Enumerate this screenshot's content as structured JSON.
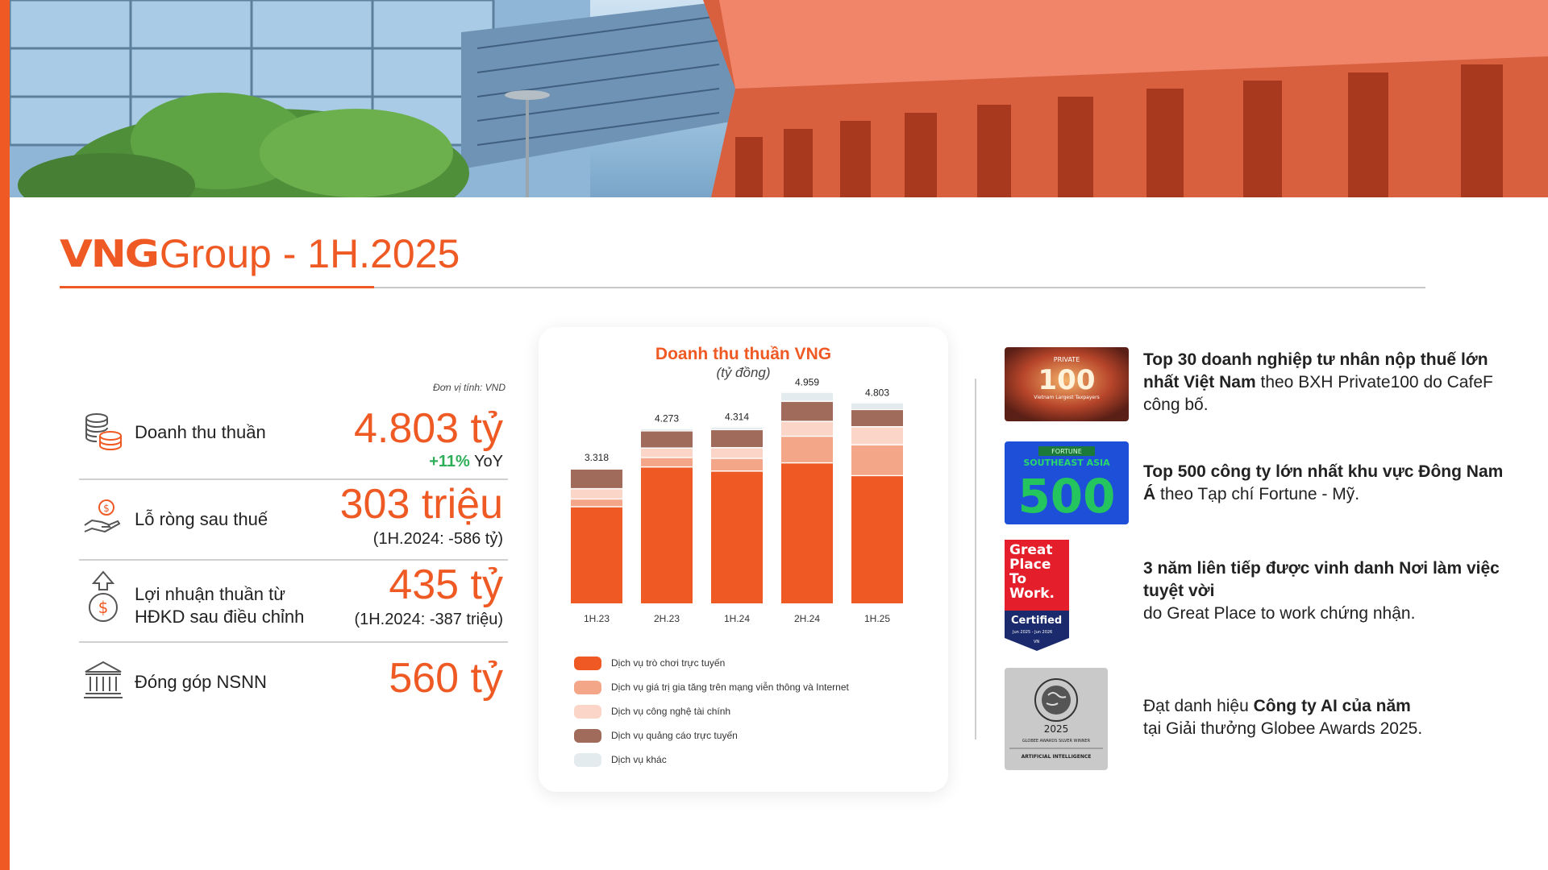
{
  "header": {
    "logo_text": "VNG",
    "title": "Group - 1H.2025"
  },
  "unit_note": "Đơn vị tính: VND",
  "kpis": [
    {
      "icon": "coins-stack-icon",
      "label": "Doanh thu thuần",
      "value": "4.803 tỷ",
      "yoy_change": "+11%",
      "yoy_label": "YoY"
    },
    {
      "icon": "hand-coin-icon",
      "label": "Lỗ ròng sau thuế",
      "value": "303 triệu",
      "note": "(1H.2024: -586 tỷ)"
    },
    {
      "icon": "money-bag-up-icon",
      "label_line1": "Lợi nhuận thuần từ",
      "label_line2": "HĐKD sau điều chỉnh",
      "value": "435 tỷ",
      "note": "(1H.2024: -387 triệu)"
    },
    {
      "icon": "government-building-icon",
      "label": "Đóng góp NSNN",
      "value": "560 tỷ"
    }
  ],
  "chart_data": {
    "type": "bar",
    "stacked": true,
    "title": "Doanh thu thuần VNG",
    "subtitle": "(tỷ đồng)",
    "categories": [
      "1H.23",
      "2H.23",
      "1H.24",
      "2H.24",
      "1H.25"
    ],
    "totals": [
      "3.318",
      "4.273",
      "4.314",
      "4.959",
      "4.803"
    ],
    "total_values": [
      3318,
      4273,
      4314,
      4959,
      4803
    ],
    "ylim": [
      0,
      5400
    ],
    "grid": false,
    "legend_position": "bottom",
    "series": [
      {
        "name": "Dịch vụ trò chơi trực tuyến",
        "color": "#ef5a24",
        "values": [
          2370,
          3340,
          3240,
          3440,
          3130
        ]
      },
      {
        "name": "Dịch vụ giá trị gia tăng trên mạng viễn thông và Internet",
        "color": "#f4a689",
        "values": [
          190,
          230,
          310,
          650,
          750
        ]
      },
      {
        "name": "Dịch vụ công nghệ tài chính",
        "color": "#fbd5c7",
        "values": [
          250,
          230,
          260,
          360,
          440
        ]
      },
      {
        "name": "Dịch vụ quảng cáo trực tuyến",
        "color": "#a06b5a",
        "values": [
          480,
          420,
          440,
          490,
          420
        ]
      },
      {
        "name": "Dịch vụ khác",
        "color": "#e3ebee",
        "values": [
          28,
          53,
          64,
          219,
          163
        ]
      }
    ]
  },
  "awards": [
    {
      "badge": "private-100-badge",
      "badge_text": [
        "PRIVATE",
        "100",
        "Vietnam Largest Taxpayers"
      ],
      "bold": "Top 30 doanh nghiệp tư nhân nộp thuế lớn nhất Việt Nam",
      "rest": " theo BXH Private100 do CafeF công bố."
    },
    {
      "badge": "fortune-sea-500-badge",
      "badge_text": [
        "FORTUNE",
        "SOUTHEAST ASIA",
        "500"
      ],
      "bold": "Top 500 công ty lớn nhất khu vực Đông Nam Á",
      "rest": " theo Tạp chí Fortune - Mỹ."
    },
    {
      "badge": "great-place-to-work-badge",
      "badge_text": [
        "Great",
        "Place",
        "To",
        "Work.",
        "Certified",
        "Jun 2025 - Jun 2026",
        "VN"
      ],
      "bold": "3 năm liên tiếp được vinh danh Nơi làm việc tuyệt vời",
      "rest": "do Great Place to work chứng nhận."
    },
    {
      "badge": "globee-awards-badge",
      "badge_text": [
        "2025",
        "GLOBEE AWARDS SILVER WINNER",
        "ARTIFICIAL INTELLIGENCE"
      ],
      "pre": "Đạt danh hiệu ",
      "bold": "Công ty AI của năm",
      "rest": "tại Giải thưởng Globee Awards 2025."
    }
  ],
  "colors": {
    "accent": "#ef5a24",
    "positive": "#2fae5a",
    "divider": "#d0d0d0"
  }
}
